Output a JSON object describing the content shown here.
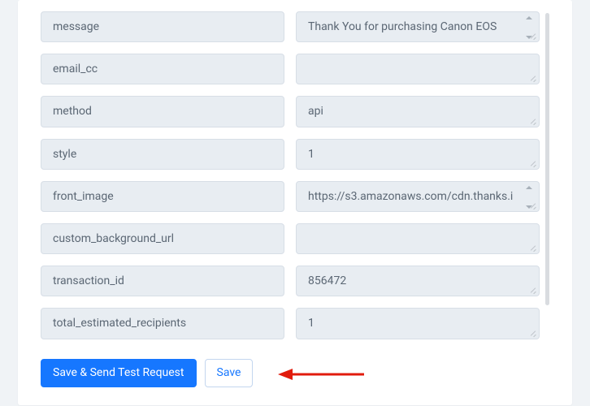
{
  "form": {
    "rows": [
      {
        "key": "message",
        "value": "Thank You for purchasing Canon EOS",
        "spinners": true
      },
      {
        "key": "email_cc",
        "value": ""
      },
      {
        "key": "method",
        "value": "api"
      },
      {
        "key": "style",
        "value": "1"
      },
      {
        "key": "front_image",
        "value": "https://s3.amazonaws.com/cdn.thanks.i",
        "spinners": true
      },
      {
        "key": "custom_background_url",
        "value": ""
      },
      {
        "key": "transaction_id",
        "value": "856472"
      },
      {
        "key": "total_estimated_recipients",
        "value": "1"
      }
    ]
  },
  "buttons": {
    "save_send": "Save & Send Test Request",
    "save": "Save"
  },
  "annotation": {
    "arrow_color": "#e11b0c"
  }
}
